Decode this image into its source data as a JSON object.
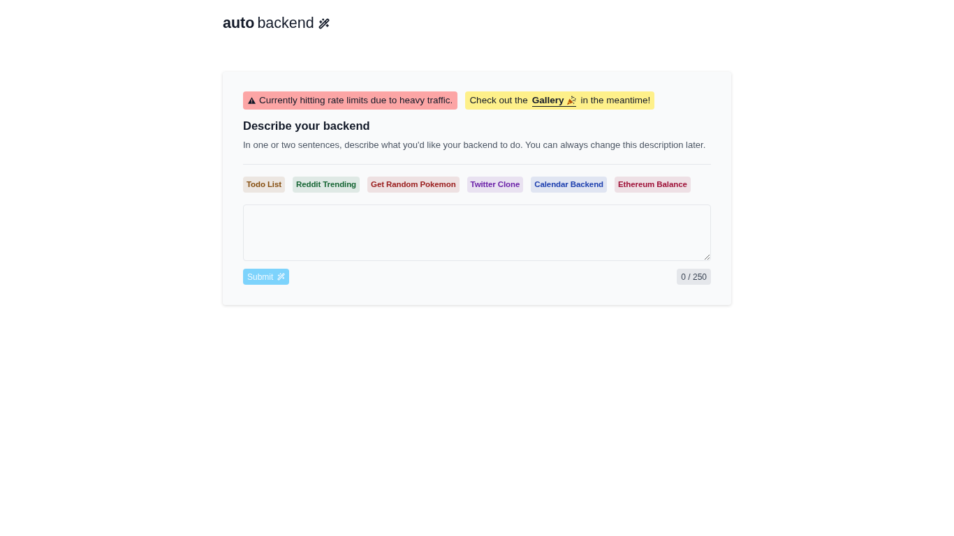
{
  "logo": {
    "bold_part": "auto",
    "regular_part": "backend"
  },
  "notices": [
    {
      "kind": "warning",
      "text": "Currently hitting rate limits due to heavy traffic."
    },
    {
      "kind": "promo",
      "before": "Check out the",
      "link": "Gallery",
      "after": "in the meantime!"
    }
  ],
  "form": {
    "heading": "Describe your backend",
    "description": "In one or two sentences, describe what you'd like your backend to do. You can always change this description later.",
    "examples": [
      {
        "label": "Todo List",
        "color": "#854d0e"
      },
      {
        "label": "Reddit Trending",
        "color": "#166534"
      },
      {
        "label": "Get Random Pokemon",
        "color": "#991b1b"
      },
      {
        "label": "Twitter Clone",
        "color": "#6b21a8"
      },
      {
        "label": "Calendar Backend",
        "color": "#1e40af"
      },
      {
        "label": "Ethereum Balance",
        "color": "#9f1239"
      }
    ],
    "submit": {
      "label": "Submit",
      "disabled": true
    },
    "counter": "0 / 250"
  }
}
